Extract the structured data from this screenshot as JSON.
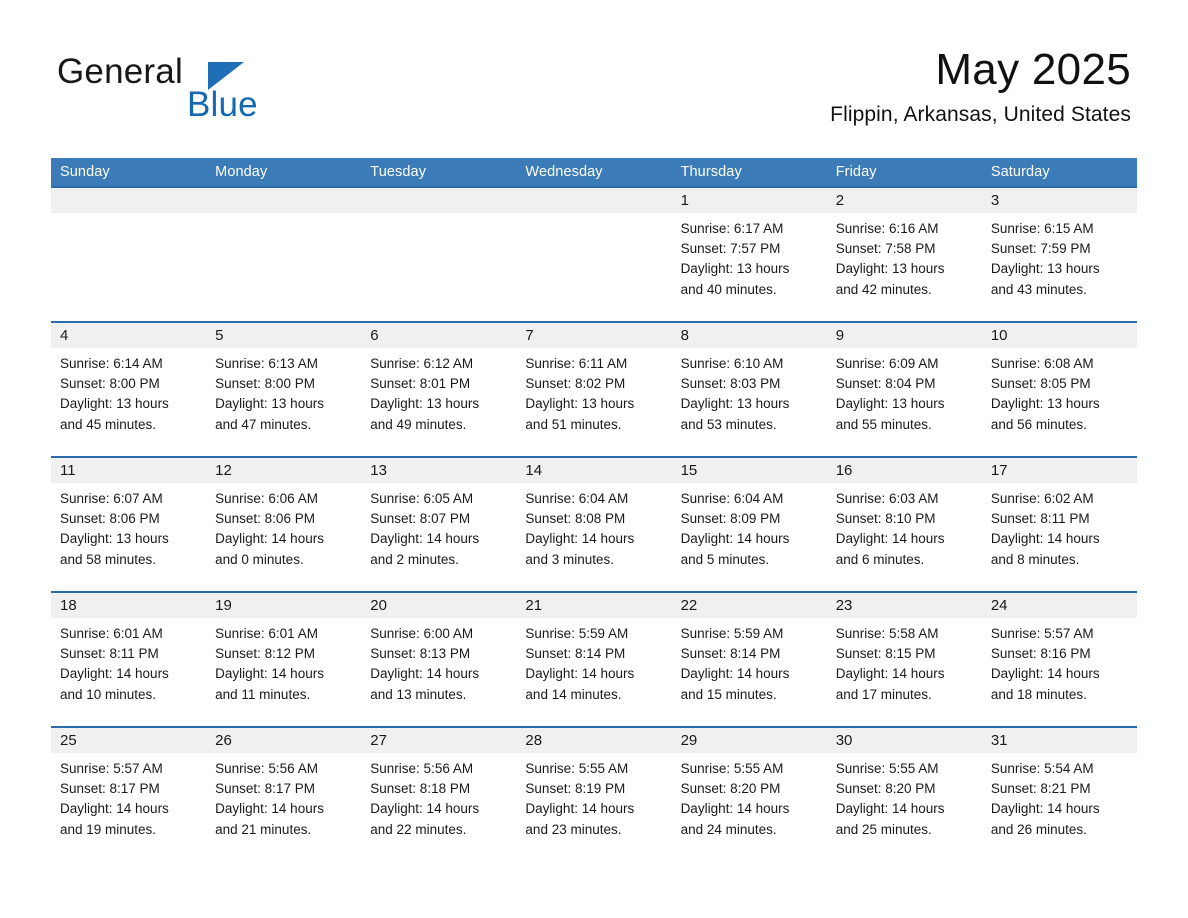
{
  "brand": {
    "name_part1": "General",
    "name_part2": "Blue",
    "colors": {
      "blue": "#1569b0",
      "header_blue": "#3b7cb8",
      "row_border_blue": "#2b6ca8",
      "date_band": "#f0f0f0"
    }
  },
  "header": {
    "month_title": "May 2025",
    "location": "Flippin, Arkansas, United States"
  },
  "weekday_headers": [
    "Sunday",
    "Monday",
    "Tuesday",
    "Wednesday",
    "Thursday",
    "Friday",
    "Saturday"
  ],
  "weeks": [
    [
      {
        "day": "",
        "sunrise": "",
        "sunset": "",
        "daylight_line1": "",
        "daylight_line2": ""
      },
      {
        "day": "",
        "sunrise": "",
        "sunset": "",
        "daylight_line1": "",
        "daylight_line2": ""
      },
      {
        "day": "",
        "sunrise": "",
        "sunset": "",
        "daylight_line1": "",
        "daylight_line2": ""
      },
      {
        "day": "",
        "sunrise": "",
        "sunset": "",
        "daylight_line1": "",
        "daylight_line2": ""
      },
      {
        "day": "1",
        "sunrise": "Sunrise: 6:17 AM",
        "sunset": "Sunset: 7:57 PM",
        "daylight_line1": "Daylight: 13 hours",
        "daylight_line2": "and 40 minutes."
      },
      {
        "day": "2",
        "sunrise": "Sunrise: 6:16 AM",
        "sunset": "Sunset: 7:58 PM",
        "daylight_line1": "Daylight: 13 hours",
        "daylight_line2": "and 42 minutes."
      },
      {
        "day": "3",
        "sunrise": "Sunrise: 6:15 AM",
        "sunset": "Sunset: 7:59 PM",
        "daylight_line1": "Daylight: 13 hours",
        "daylight_line2": "and 43 minutes."
      }
    ],
    [
      {
        "day": "4",
        "sunrise": "Sunrise: 6:14 AM",
        "sunset": "Sunset: 8:00 PM",
        "daylight_line1": "Daylight: 13 hours",
        "daylight_line2": "and 45 minutes."
      },
      {
        "day": "5",
        "sunrise": "Sunrise: 6:13 AM",
        "sunset": "Sunset: 8:00 PM",
        "daylight_line1": "Daylight: 13 hours",
        "daylight_line2": "and 47 minutes."
      },
      {
        "day": "6",
        "sunrise": "Sunrise: 6:12 AM",
        "sunset": "Sunset: 8:01 PM",
        "daylight_line1": "Daylight: 13 hours",
        "daylight_line2": "and 49 minutes."
      },
      {
        "day": "7",
        "sunrise": "Sunrise: 6:11 AM",
        "sunset": "Sunset: 8:02 PM",
        "daylight_line1": "Daylight: 13 hours",
        "daylight_line2": "and 51 minutes."
      },
      {
        "day": "8",
        "sunrise": "Sunrise: 6:10 AM",
        "sunset": "Sunset: 8:03 PM",
        "daylight_line1": "Daylight: 13 hours",
        "daylight_line2": "and 53 minutes."
      },
      {
        "day": "9",
        "sunrise": "Sunrise: 6:09 AM",
        "sunset": "Sunset: 8:04 PM",
        "daylight_line1": "Daylight: 13 hours",
        "daylight_line2": "and 55 minutes."
      },
      {
        "day": "10",
        "sunrise": "Sunrise: 6:08 AM",
        "sunset": "Sunset: 8:05 PM",
        "daylight_line1": "Daylight: 13 hours",
        "daylight_line2": "and 56 minutes."
      }
    ],
    [
      {
        "day": "11",
        "sunrise": "Sunrise: 6:07 AM",
        "sunset": "Sunset: 8:06 PM",
        "daylight_line1": "Daylight: 13 hours",
        "daylight_line2": "and 58 minutes."
      },
      {
        "day": "12",
        "sunrise": "Sunrise: 6:06 AM",
        "sunset": "Sunset: 8:06 PM",
        "daylight_line1": "Daylight: 14 hours",
        "daylight_line2": "and 0 minutes."
      },
      {
        "day": "13",
        "sunrise": "Sunrise: 6:05 AM",
        "sunset": "Sunset: 8:07 PM",
        "daylight_line1": "Daylight: 14 hours",
        "daylight_line2": "and 2 minutes."
      },
      {
        "day": "14",
        "sunrise": "Sunrise: 6:04 AM",
        "sunset": "Sunset: 8:08 PM",
        "daylight_line1": "Daylight: 14 hours",
        "daylight_line2": "and 3 minutes."
      },
      {
        "day": "15",
        "sunrise": "Sunrise: 6:04 AM",
        "sunset": "Sunset: 8:09 PM",
        "daylight_line1": "Daylight: 14 hours",
        "daylight_line2": "and 5 minutes."
      },
      {
        "day": "16",
        "sunrise": "Sunrise: 6:03 AM",
        "sunset": "Sunset: 8:10 PM",
        "daylight_line1": "Daylight: 14 hours",
        "daylight_line2": "and 6 minutes."
      },
      {
        "day": "17",
        "sunrise": "Sunrise: 6:02 AM",
        "sunset": "Sunset: 8:11 PM",
        "daylight_line1": "Daylight: 14 hours",
        "daylight_line2": "and 8 minutes."
      }
    ],
    [
      {
        "day": "18",
        "sunrise": "Sunrise: 6:01 AM",
        "sunset": "Sunset: 8:11 PM",
        "daylight_line1": "Daylight: 14 hours",
        "daylight_line2": "and 10 minutes."
      },
      {
        "day": "19",
        "sunrise": "Sunrise: 6:01 AM",
        "sunset": "Sunset: 8:12 PM",
        "daylight_line1": "Daylight: 14 hours",
        "daylight_line2": "and 11 minutes."
      },
      {
        "day": "20",
        "sunrise": "Sunrise: 6:00 AM",
        "sunset": "Sunset: 8:13 PM",
        "daylight_line1": "Daylight: 14 hours",
        "daylight_line2": "and 13 minutes."
      },
      {
        "day": "21",
        "sunrise": "Sunrise: 5:59 AM",
        "sunset": "Sunset: 8:14 PM",
        "daylight_line1": "Daylight: 14 hours",
        "daylight_line2": "and 14 minutes."
      },
      {
        "day": "22",
        "sunrise": "Sunrise: 5:59 AM",
        "sunset": "Sunset: 8:14 PM",
        "daylight_line1": "Daylight: 14 hours",
        "daylight_line2": "and 15 minutes."
      },
      {
        "day": "23",
        "sunrise": "Sunrise: 5:58 AM",
        "sunset": "Sunset: 8:15 PM",
        "daylight_line1": "Daylight: 14 hours",
        "daylight_line2": "and 17 minutes."
      },
      {
        "day": "24",
        "sunrise": "Sunrise: 5:57 AM",
        "sunset": "Sunset: 8:16 PM",
        "daylight_line1": "Daylight: 14 hours",
        "daylight_line2": "and 18 minutes."
      }
    ],
    [
      {
        "day": "25",
        "sunrise": "Sunrise: 5:57 AM",
        "sunset": "Sunset: 8:17 PM",
        "daylight_line1": "Daylight: 14 hours",
        "daylight_line2": "and 19 minutes."
      },
      {
        "day": "26",
        "sunrise": "Sunrise: 5:56 AM",
        "sunset": "Sunset: 8:17 PM",
        "daylight_line1": "Daylight: 14 hours",
        "daylight_line2": "and 21 minutes."
      },
      {
        "day": "27",
        "sunrise": "Sunrise: 5:56 AM",
        "sunset": "Sunset: 8:18 PM",
        "daylight_line1": "Daylight: 14 hours",
        "daylight_line2": "and 22 minutes."
      },
      {
        "day": "28",
        "sunrise": "Sunrise: 5:55 AM",
        "sunset": "Sunset: 8:19 PM",
        "daylight_line1": "Daylight: 14 hours",
        "daylight_line2": "and 23 minutes."
      },
      {
        "day": "29",
        "sunrise": "Sunrise: 5:55 AM",
        "sunset": "Sunset: 8:20 PM",
        "daylight_line1": "Daylight: 14 hours",
        "daylight_line2": "and 24 minutes."
      },
      {
        "day": "30",
        "sunrise": "Sunrise: 5:55 AM",
        "sunset": "Sunset: 8:20 PM",
        "daylight_line1": "Daylight: 14 hours",
        "daylight_line2": "and 25 minutes."
      },
      {
        "day": "31",
        "sunrise": "Sunrise: 5:54 AM",
        "sunset": "Sunset: 8:21 PM",
        "daylight_line1": "Daylight: 14 hours",
        "daylight_line2": "and 26 minutes."
      }
    ]
  ]
}
